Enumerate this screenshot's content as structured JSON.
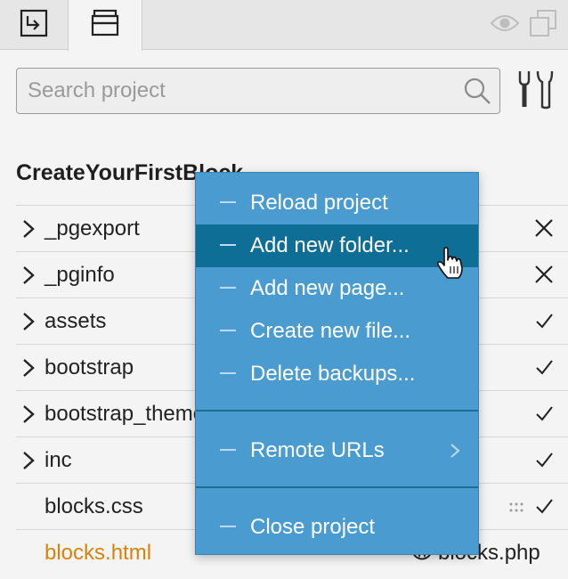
{
  "tabs": [
    {
      "name": "export-tab",
      "icon": "export-icon"
    },
    {
      "name": "project-tab",
      "icon": "inbox-icon",
      "active": true
    }
  ],
  "toolbar_icons": [
    "eye-icon",
    "copy-icon"
  ],
  "search": {
    "placeholder": "Search project"
  },
  "project": {
    "title": "CreateYourFirstBlock"
  },
  "files": [
    {
      "label": "_pgexport",
      "folder": true,
      "status": "remove"
    },
    {
      "label": "_pginfo",
      "folder": true,
      "status": "remove"
    },
    {
      "label": "assets",
      "folder": true,
      "status": "check"
    },
    {
      "label": "bootstrap",
      "folder": true,
      "status": "check"
    },
    {
      "label": "bootstrap_theme",
      "folder": true,
      "status": "check"
    },
    {
      "label": "inc",
      "folder": true,
      "status": "check"
    },
    {
      "label": "blocks.css",
      "folder": false,
      "status": "check"
    },
    {
      "label": "blocks.html",
      "folder": false,
      "status": "",
      "side_file": "blocks.php"
    }
  ],
  "context_menu": {
    "items": [
      {
        "label": "Reload project"
      },
      {
        "label": "Add new folder..."
      },
      {
        "label": "Add new page..."
      },
      {
        "label": "Create new file..."
      },
      {
        "label": "Delete backups..."
      },
      {
        "label": "Remote URLs"
      },
      {
        "label": "Close project"
      }
    ],
    "active_index": 1
  },
  "colors": {
    "menu_bg": "#4a9cd0",
    "menu_active": "#0e6e96",
    "accent_orange": "#d9820b"
  }
}
